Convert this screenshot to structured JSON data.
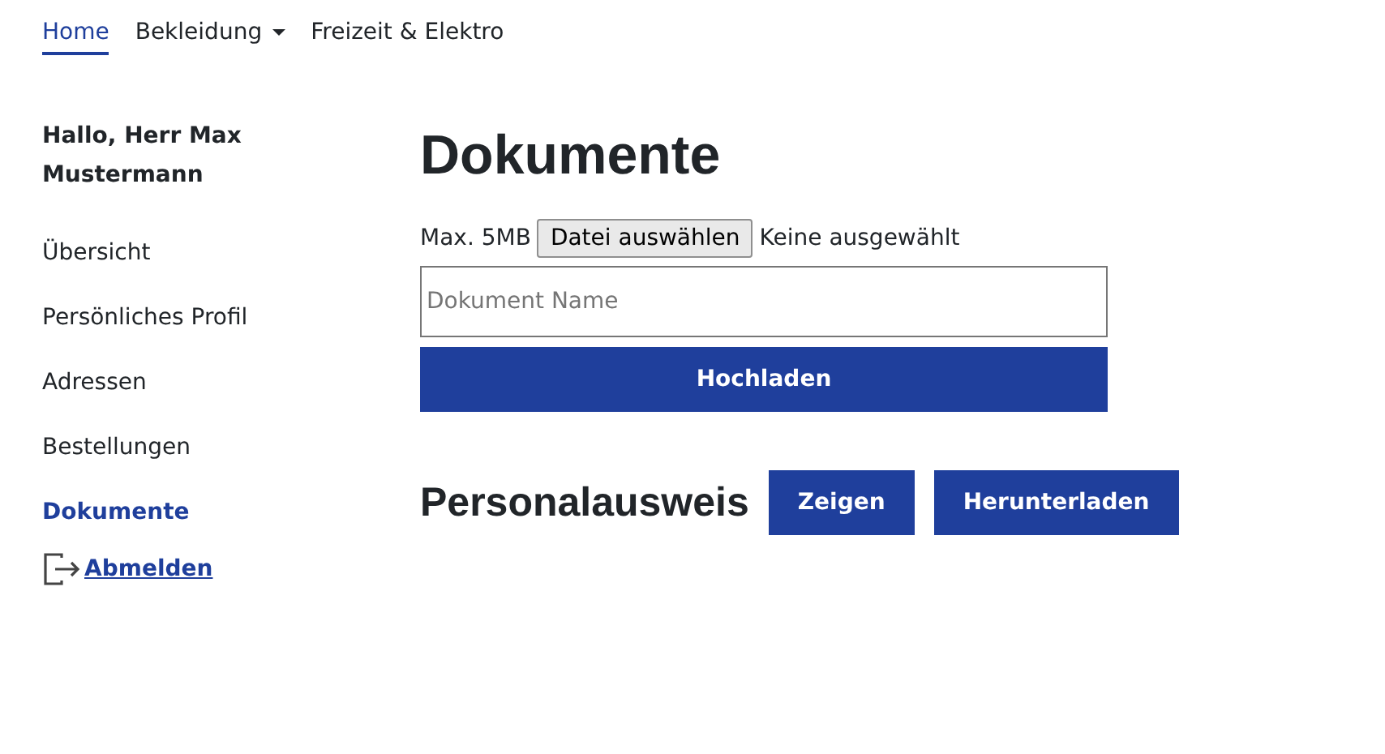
{
  "nav": [
    {
      "label": "Home",
      "selected": true,
      "kind": "link"
    },
    {
      "label": "Bekleidung",
      "selected": false,
      "kind": "dropdown"
    },
    {
      "label": "Freizeit & Elektro",
      "selected": false,
      "kind": "link"
    }
  ],
  "sidebar": {
    "greeting": "Hallo, Herr Max Mustermann",
    "items": [
      {
        "label": "Übersicht",
        "selected": false
      },
      {
        "label": "Persönliches Profil",
        "selected": false
      },
      {
        "label": "Adressen",
        "selected": false
      },
      {
        "label": "Bestellungen",
        "selected": false
      },
      {
        "label": "Dokumente",
        "selected": true
      }
    ],
    "logout": "Abmelden"
  },
  "main": {
    "title": "Dokumente",
    "upload": {
      "limit": "Max. 5MB",
      "file_button": "Datei auswählen",
      "file_status": "Keine ausgewählt",
      "name_placeholder": "Dokument Name",
      "submit": "Hochladen"
    },
    "documents": [
      {
        "name": "Personalausweis",
        "actions": [
          "Zeigen",
          "Herunterladen"
        ]
      }
    ]
  }
}
